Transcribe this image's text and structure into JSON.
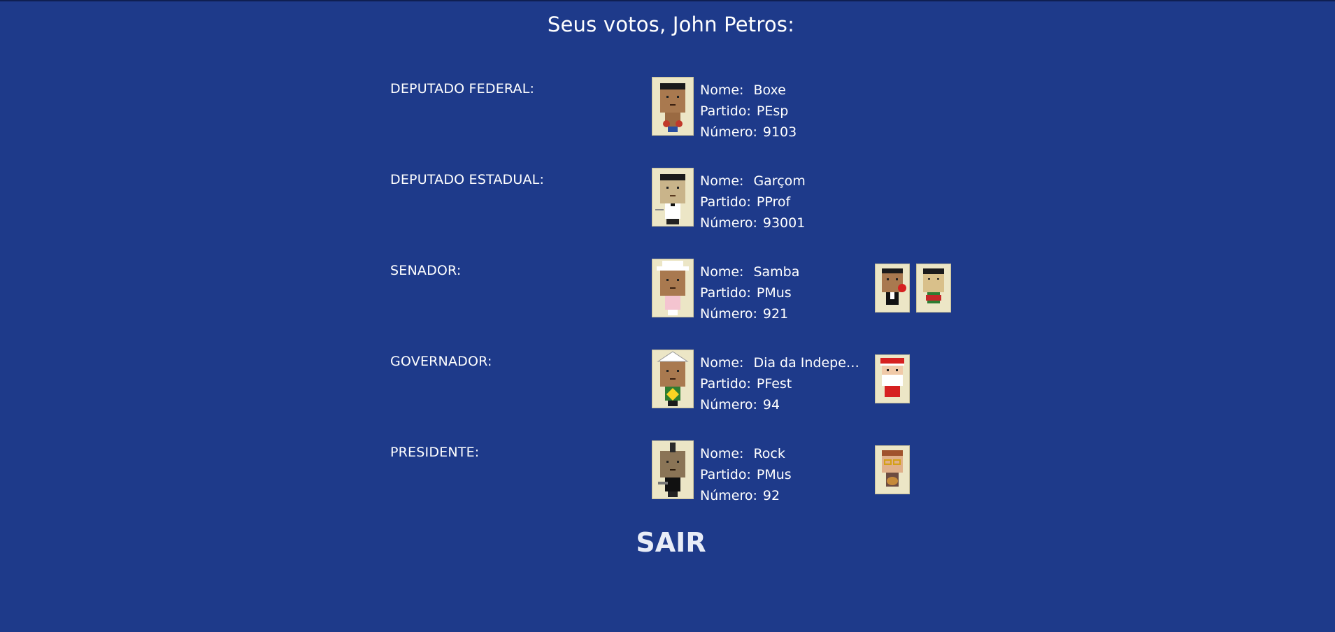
{
  "header": {
    "title": "Seus votos, John Petros:"
  },
  "labels": {
    "nome": "Nome:",
    "partido": "Partido:",
    "numero": "Número:"
  },
  "votes": [
    {
      "role": "DEPUTADO FEDERAL:",
      "nome": "Boxe",
      "partido": "PEsp",
      "numero": "9103",
      "avatar": "boxer-avatar"
    },
    {
      "role": "DEPUTADO ESTADUAL:",
      "nome": "Garçom",
      "partido": "PProf",
      "numero": "93001",
      "avatar": "waiter-avatar"
    },
    {
      "role": "SENADOR:",
      "nome": "Samba",
      "partido": "PMus",
      "numero": "921",
      "avatar": "samba-avatar",
      "vices": [
        "singer-avatar",
        "drummer-avatar"
      ]
    },
    {
      "role": "GOVERNADOR:",
      "nome": "Dia da Independência",
      "partido": "PFest",
      "numero": "94",
      "avatar": "independence-day-avatar",
      "vices": [
        "santa-claus-avatar"
      ]
    },
    {
      "role": "PRESIDENTE:",
      "nome": "Rock",
      "partido": "PMus",
      "numero": "92",
      "avatar": "rock-avatar",
      "vices": [
        "guitarist-avatar"
      ]
    }
  ],
  "actions": {
    "exit_label": "SAIR"
  },
  "colors": {
    "background": "#1e3a8a",
    "card": "#ece6c6",
    "skin": "#a9794f"
  }
}
